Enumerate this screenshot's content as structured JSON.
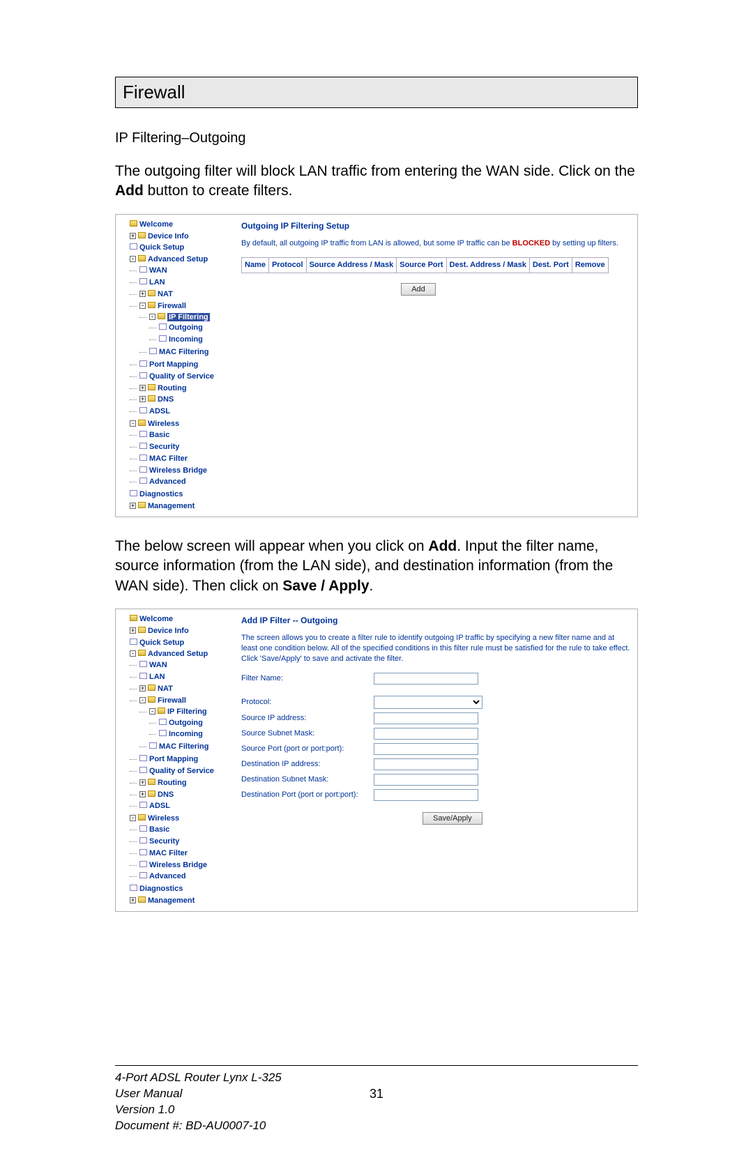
{
  "section_title": "Firewall",
  "subheading": "IP Filtering–Outgoing",
  "para1_pre": "The outgoing filter will block LAN traffic from entering the WAN side.  Click on the ",
  "para1_bold": "Add",
  "para1_post": " button to create filters.",
  "tree": {
    "welcome": "Welcome",
    "device_info": "Device Info",
    "quick_setup": "Quick Setup",
    "advanced_setup": "Advanced Setup",
    "wan": "WAN",
    "lan": "LAN",
    "nat": "NAT",
    "firewall": "Firewall",
    "ip_filtering": "IP Filtering",
    "outgoing": "Outgoing",
    "incoming": "Incoming",
    "mac_filtering": "MAC Filtering",
    "port_mapping": "Port Mapping",
    "quality_of_service": "Quality of Service",
    "routing": "Routing",
    "dns": "DNS",
    "adsl": "ADSL",
    "wireless": "Wireless",
    "basic": "Basic",
    "security": "Security",
    "mac_filter": "MAC Filter",
    "wireless_bridge": "Wireless Bridge",
    "advanced": "Advanced",
    "diagnostics": "Diagnostics",
    "management": "Management"
  },
  "panel1": {
    "title": "Outgoing IP Filtering Setup",
    "desc_pre": "By default, all outgoing IP traffic from LAN is allowed, but some IP traffic can be ",
    "desc_bold": "BLOCKED",
    "desc_post": " by setting up filters.",
    "cols": [
      "Name",
      "Protocol",
      "Source Address / Mask",
      "Source Port",
      "Dest. Address / Mask",
      "Dest. Port",
      "Remove"
    ],
    "add_label": "Add"
  },
  "para2_pre": "The below screen will appear when you click on ",
  "para2_bold1": "Add",
  "para2_mid": ".  Input the filter name, source information (from the LAN side), and destination information (from the WAN side). Then click on ",
  "para2_bold2": "Save / Apply",
  "para2_post": ".",
  "panel2": {
    "title": "Add IP Filter -- Outgoing",
    "desc": "The screen allows you to create a filter rule to identify outgoing IP traffic by specifying a new filter name and at least one condition below. All of the specified conditions in this filter rule must be satisfied for the rule to take effect. Click 'Save/Apply' to save and activate the filter.",
    "fields": {
      "filter_name": "Filter Name:",
      "protocol": "Protocol:",
      "src_ip": "Source IP address:",
      "src_mask": "Source Subnet Mask:",
      "src_port": "Source Port (port or port:port):",
      "dst_ip": "Destination IP address:",
      "dst_mask": "Destination Subnet Mask:",
      "dst_port": "Destination Port (port or port:port):"
    },
    "save_label": "Save/Apply"
  },
  "footer": {
    "line1": "4-Port ADSL Router Lynx L-325",
    "line2": "User Manual",
    "line3": "Version 1.0",
    "line4": "Document #:  BD-AU0007-10",
    "page": "31"
  }
}
